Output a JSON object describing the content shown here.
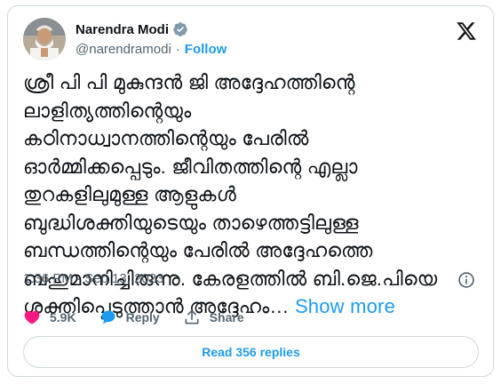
{
  "author": {
    "name": "Narendra Modi",
    "handle": "@narendramodi",
    "follow_label": "Follow",
    "separator": "·"
  },
  "tweet": {
    "text": "ശ്രീ പി പി മുകുന്ദൻ ജി അദ്ദേഹത്തിന്റെ\nലാളിത്യത്തിന്റെയും\nകഠിനാധ്വാനത്തിന്റെയും പേരിൽ\nഓർമ്മിക്കപ്പെടും. ജീവിതത്തിന്റെ എല്ലാ\nതുറകളിലുമുള്ള ആളുകൾ\nബുദ്ധിശക്തിയുടെയും താഴെത്തട്ടിലുള്ള\nബന്ധത്തിന്റെയും പേരിൽ അദ്ദേഹത്തെ\nബഹുമാനിച്ചിരുന്നു. കേരളത്തിൽ ബി.ജെ.പിയെ\nശക്തിപ്പെടുത്താൻ അദ്ദേഹം…",
    "show_more": "Show more",
    "timestamp": "1:36 PM · Sep 13, 2023"
  },
  "actions": {
    "likes": "5.9K",
    "reply_label": "Reply",
    "share_label": "Share"
  },
  "read_replies": "Read 356 replies",
  "colors": {
    "accent": "#1d9bf0",
    "like": "#f91880",
    "muted": "#536471",
    "border": "#cfd9de"
  },
  "icons": [
    "verified-badge-icon",
    "x-logo-icon",
    "info-icon",
    "heart-icon",
    "reply-bubble-icon",
    "share-icon"
  ]
}
